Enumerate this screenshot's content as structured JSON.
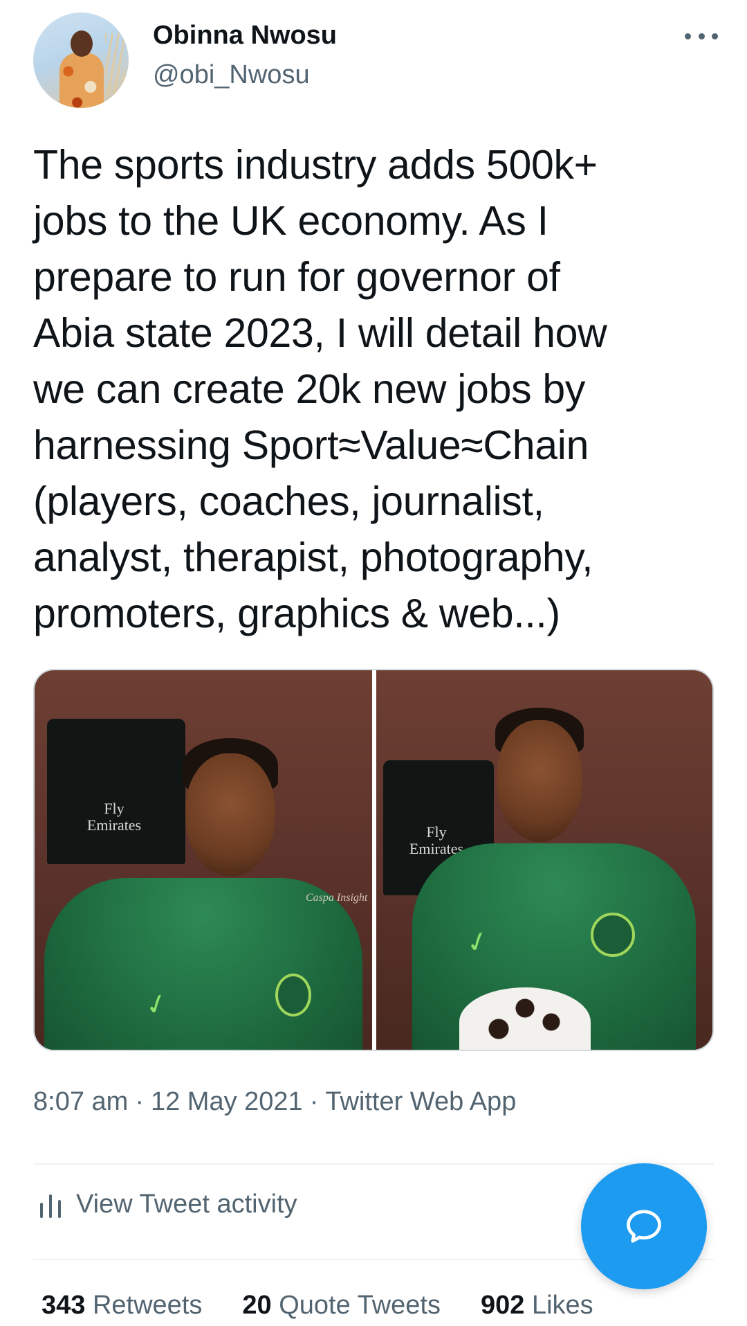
{
  "tweet": {
    "author": {
      "display_name": "Obinna Nwosu",
      "handle": "@obi_Nwosu"
    },
    "text": "The sports industry adds 500k+\njobs to the UK economy. As I\nprepare to run for governor of\nAbia state 2023, I will detail how\nwe can create 20k new jobs by\nharnessing Sport≈Value≈Chain\n(players, coaches, journalist,\nanalyst, therapist, photography,\npromoters, graphics & web...)",
    "media": {
      "photo_left": {
        "jersey_text": "Fly\nEmirates",
        "signature": "Caspa Insight"
      },
      "photo_right": {
        "jersey_text": "Fly\nEmirates"
      }
    },
    "meta": {
      "time": "8:07 am",
      "separator": "·",
      "date": "12 May 2021",
      "source": "Twitter Web App"
    },
    "activity_label": "View Tweet activity",
    "stats": {
      "retweets_count": "343",
      "retweets_label": "Retweets",
      "quote_count": "20",
      "quote_label": "Quote Tweets",
      "likes_count": "902",
      "likes_label": "Likes"
    }
  },
  "icons": {
    "more": "more-horizontal-icon",
    "activity": "bar-chart-icon",
    "compose": "speech-bubble-icon"
  },
  "colors": {
    "accent": "#1d9bf0",
    "text_primary": "#0f1419",
    "text_secondary": "#536471",
    "divider": "#eff3f4"
  }
}
